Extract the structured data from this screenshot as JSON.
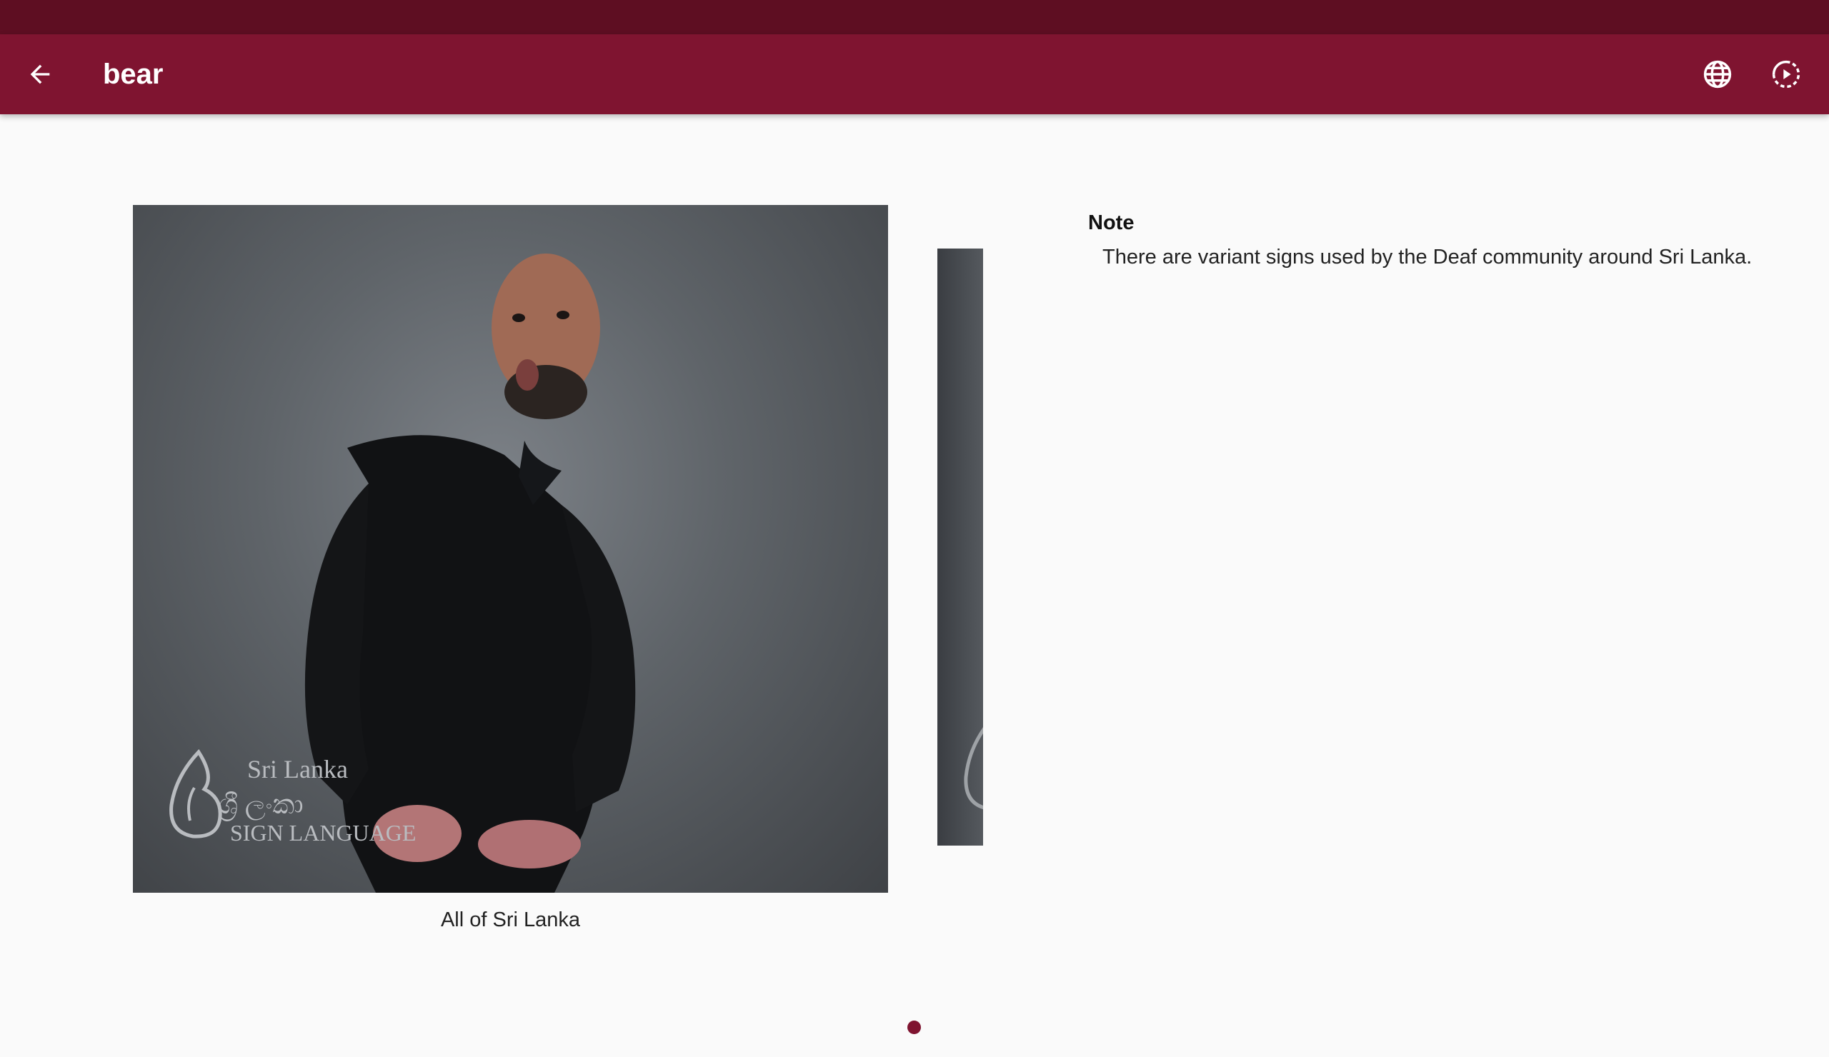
{
  "app_bar": {
    "title": "bear",
    "back_icon": "arrow-left-icon",
    "language_icon": "globe-icon",
    "autoplay_icon": "play-circle-icon"
  },
  "video": {
    "watermark_line1": "Sri Lanka",
    "watermark_line2": "ශ්‍රී ලංකා",
    "watermark_line3": "SIGN LANGUAGE",
    "caption": "All of Sri Lanka"
  },
  "note": {
    "heading": "Note",
    "text": "There are variant signs used by the Deaf community around Sri Lanka."
  },
  "pagination": {
    "total": 1,
    "current": 1
  },
  "colors": {
    "status_bar": "#5e0e22",
    "app_bar": "#7f1430",
    "background": "#fafafa",
    "accent": "#7f1430"
  }
}
